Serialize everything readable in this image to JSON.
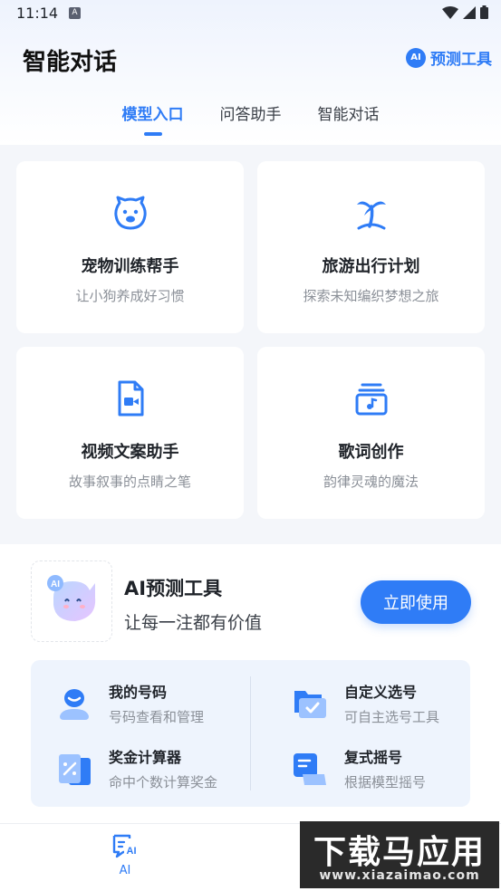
{
  "status_bar": {
    "time": "11:14",
    "notification_badge": "A"
  },
  "header": {
    "title": "智能对话",
    "tool_link": {
      "badge": "AI",
      "label": "预测工具"
    }
  },
  "tabs": [
    {
      "label": "模型入口",
      "active": true
    },
    {
      "label": "问答助手",
      "active": false
    },
    {
      "label": "智能对话",
      "active": false
    }
  ],
  "cards": [
    {
      "title": "宠物训练帮手",
      "subtitle": "让小狗养成好习惯",
      "icon": "dog-icon"
    },
    {
      "title": "旅游出行计划",
      "subtitle": "探索未知编织梦想之旅",
      "icon": "palm-tree-icon"
    },
    {
      "title": "视频文案助手",
      "subtitle": "故事叙事的点睛之笔",
      "icon": "video-document-icon"
    },
    {
      "title": "歌词创作",
      "subtitle": "韵律灵魂的魔法",
      "icon": "music-box-icon"
    }
  ],
  "promo": {
    "title": "AI预测工具",
    "subtitle": "让每一注都有价值",
    "button": "立即使用",
    "mascot_badge": "AI"
  },
  "features": [
    {
      "title": "我的号码",
      "subtitle": "号码查看和管理",
      "icon": "user-number-icon"
    },
    {
      "title": "自定义选号",
      "subtitle": "可自主选号工具",
      "icon": "folder-check-icon"
    },
    {
      "title": "奖金计算器",
      "subtitle": "命中个数计算奖金",
      "icon": "calculator-icon"
    },
    {
      "title": "复式摇号",
      "subtitle": "根据模型摇号",
      "icon": "layers-doc-icon"
    }
  ],
  "bottom_nav": {
    "ai_label": "AI"
  },
  "watermark": {
    "text": "下载马应用",
    "url": "www.xiazaimao.com"
  },
  "colors": {
    "accent": "#2f7cf6",
    "background": "#f4f6fa"
  }
}
